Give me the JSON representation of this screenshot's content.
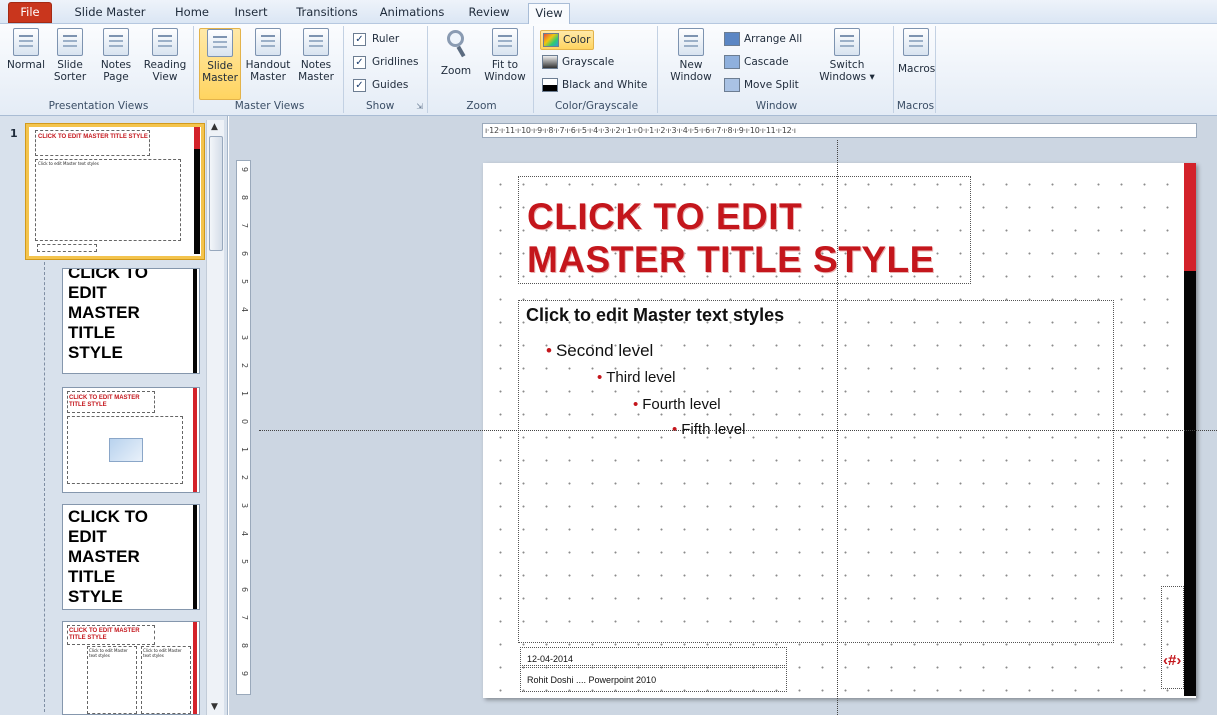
{
  "tabs": [
    "File",
    "Slide Master",
    "Home",
    "Insert",
    "Transitions",
    "Animations",
    "Review",
    "View"
  ],
  "ribbon": {
    "presentation_views": {
      "label": "Presentation Views",
      "buttons": [
        {
          "l1": "Normal",
          "l2": ""
        },
        {
          "l1": "Slide",
          "l2": "Sorter"
        },
        {
          "l1": "Notes",
          "l2": "Page"
        },
        {
          "l1": "Reading",
          "l2": "View"
        }
      ]
    },
    "master_views": {
      "label": "Master Views",
      "buttons": [
        {
          "l1": "Slide",
          "l2": "Master"
        },
        {
          "l1": "Handout",
          "l2": "Master"
        },
        {
          "l1": "Notes",
          "l2": "Master"
        }
      ]
    },
    "show": {
      "label": "Show",
      "ruler": "Ruler",
      "gridlines": "Gridlines",
      "guides": "Guides",
      "checkmark": "✓",
      "ruler_checked": true,
      "gridlines_checked": true,
      "guides_checked": true
    },
    "zoom": {
      "label": "Zoom",
      "zoom_label": "Zoom",
      "fit_l1": "Fit to",
      "fit_l2": "Window"
    },
    "color_grayscale": {
      "label": "Color/Grayscale",
      "color": "Color",
      "grayscale": "Grayscale",
      "bw": "Black and White"
    },
    "window": {
      "label": "Window",
      "new_l1": "New",
      "new_l2": "Window",
      "arrange_all": "Arrange All",
      "cascade": "Cascade",
      "move_split": "Move Split",
      "switch_l1": "Switch",
      "switch_l2": "Windows ▾"
    },
    "macros": {
      "label": "Macros",
      "btn": "Macros"
    }
  },
  "thumbnails": {
    "number": "1",
    "t1_title": "CLICK TO EDIT MASTER TITLE STYLE",
    "t1_body": "Click to edit Master text styles",
    "t2_lines": [
      "CLICK TO",
      "EDIT",
      "MASTER",
      "TITLE",
      "STYLE"
    ],
    "t3_title": "CLICK TO EDIT MASTER TITLE STYLE",
    "t4_lines": [
      "CLICK TO",
      "EDIT",
      "MASTER",
      "TITLE",
      "STYLE"
    ],
    "t5_title": "CLICK TO EDIT MASTER TITLE STYLE",
    "t5_col1": "Click to edit Master text styles",
    "t5_col2": "Click to edit Master text styles"
  },
  "ruler": {
    "horizontal": "ı·12·ı·11·ı·10·ı·9·ı·8·ı·7·ı·6·ı·5·ı·4·ı·3·ı·2·ı·1·ı·0·ı·1·ı·2·ı·3·ı·4·ı·5·ı·6·ı·7·ı·8·ı·9·ı·10·ı·11·ı·12·ı",
    "vertical": [
      "9",
      "8",
      "7",
      "6",
      "5",
      "4",
      "3",
      "2",
      "1",
      "0",
      "1",
      "2",
      "3",
      "4",
      "5",
      "6",
      "7",
      "8",
      "9"
    ]
  },
  "slide": {
    "title_line1": "CLICK TO EDIT",
    "title_line2": "MASTER TITLE STYLE",
    "body": "Click to edit Master text styles",
    "level2": "Second level",
    "level3": "Third level",
    "level4": "Fourth  level",
    "level5": "Fifth level",
    "bullet": "•",
    "date": "12-04-2014",
    "footer": "Rohit Doshi   ....  Powerpoint 2010",
    "slide_number": "‹#›"
  },
  "colors": {
    "accent_red": "#c4161c",
    "selection_gold": "#f4c44d",
    "file_tab": "#c9361d"
  },
  "icons": {
    "zoom": "magnifier-icon",
    "fit": "fit-to-window-icon",
    "new_window": "new-window-icon"
  }
}
